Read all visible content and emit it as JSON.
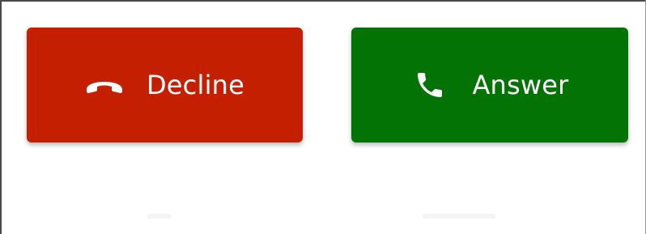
{
  "call_actions": {
    "decline": {
      "label": "Decline",
      "icon": "phone-hangup-icon",
      "color": "#c42000"
    },
    "answer": {
      "label": "Answer",
      "icon": "phone-icon",
      "color": "#047306"
    }
  }
}
